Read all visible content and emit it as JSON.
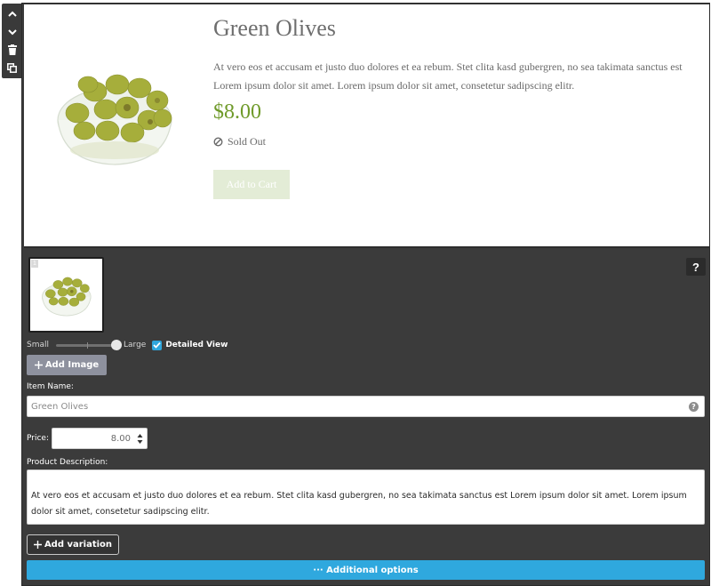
{
  "toolbar": {
    "items": [
      {
        "name": "move-up",
        "icon": "chevron-up-icon"
      },
      {
        "name": "move-down",
        "icon": "chevron-down-icon"
      },
      {
        "name": "delete",
        "icon": "trash-icon"
      },
      {
        "name": "duplicate",
        "icon": "copy-icon"
      }
    ]
  },
  "preview": {
    "title": "Green Olives",
    "description": "At vero eos et accusam et justo duo dolores et ea rebum. Stet clita kasd gubergren, no sea takimata sanctus est Lorem ipsum dolor sit amet. Lorem ipsum dolor sit amet, consetetur sadipscing elitr.",
    "price": "$8.00",
    "status": "Sold Out",
    "status_icon": "no-entry-icon",
    "add_to_cart_label": "Add to Cart",
    "image_alt": "bowl of green olives"
  },
  "editor": {
    "help_label": "?",
    "thumbnail_index": "1",
    "size_small_label": "Small",
    "size_large_label": "Large",
    "size_slider_value": 1.0,
    "detailed_view_label": "Detailed View",
    "detailed_view_checked": true,
    "add_image_label": "Add Image",
    "item_name_label": "Item Name:",
    "item_name_value": "Green Olives",
    "price_label": "Price:",
    "price_value": "8.00",
    "description_label": "Product Description:",
    "description_value": "At vero eos et accusam et justo duo dolores et ea rebum. Stet clita kasd gubergren, no sea takimata sanctus est Lorem ipsum dolor sit amet. Lorem ipsum dolor sit amet, consetetur sadipscing elitr.",
    "add_variation_label": "Add variation",
    "additional_options_label": "··· Additional options"
  },
  "colors": {
    "accent_blue": "#2fa8de",
    "price_green": "#6f9a2a",
    "panel_dark": "#3b3b3b"
  }
}
